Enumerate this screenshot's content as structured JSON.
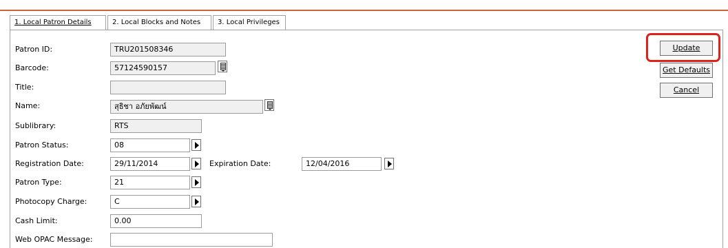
{
  "tabs": [
    {
      "label": "1. Local Patron Details"
    },
    {
      "label": "2. Local Blocks and Notes"
    },
    {
      "label": "3. Local Privileges"
    }
  ],
  "form": {
    "patron_id": {
      "label": "Patron ID:",
      "value": "TRU201508346"
    },
    "barcode": {
      "label": "Barcode:",
      "value": "57124590157"
    },
    "title": {
      "label": "Title:",
      "value": ""
    },
    "name": {
      "label": "Name:",
      "value": "สุธิชา อภัยพัฒน์"
    },
    "sublibrary": {
      "label": "Sublibrary:",
      "value": "RTS"
    },
    "patron_status": {
      "label": "Patron Status:",
      "value": "08"
    },
    "registration_date": {
      "label": "Registration Date:",
      "value": "29/11/2014"
    },
    "expiration_date": {
      "label": "Expiration Date:",
      "value": "12/04/2016"
    },
    "patron_type": {
      "label": "Patron Type:",
      "value": "21"
    },
    "photocopy_charge": {
      "label": "Photocopy Charge:",
      "value": "C"
    },
    "cash_limit": {
      "label": "Cash Limit:",
      "value": "0.00"
    },
    "web_opac_message": {
      "label": "Web OPAC Message:",
      "value": ""
    }
  },
  "buttons": {
    "update": "Update",
    "get_defaults": "Get Defaults",
    "cancel": "Cancel"
  },
  "colors": {
    "highlight": "#e0201c",
    "top_rule": "#c8643c",
    "readonly_bg": "#f0f0f0"
  }
}
